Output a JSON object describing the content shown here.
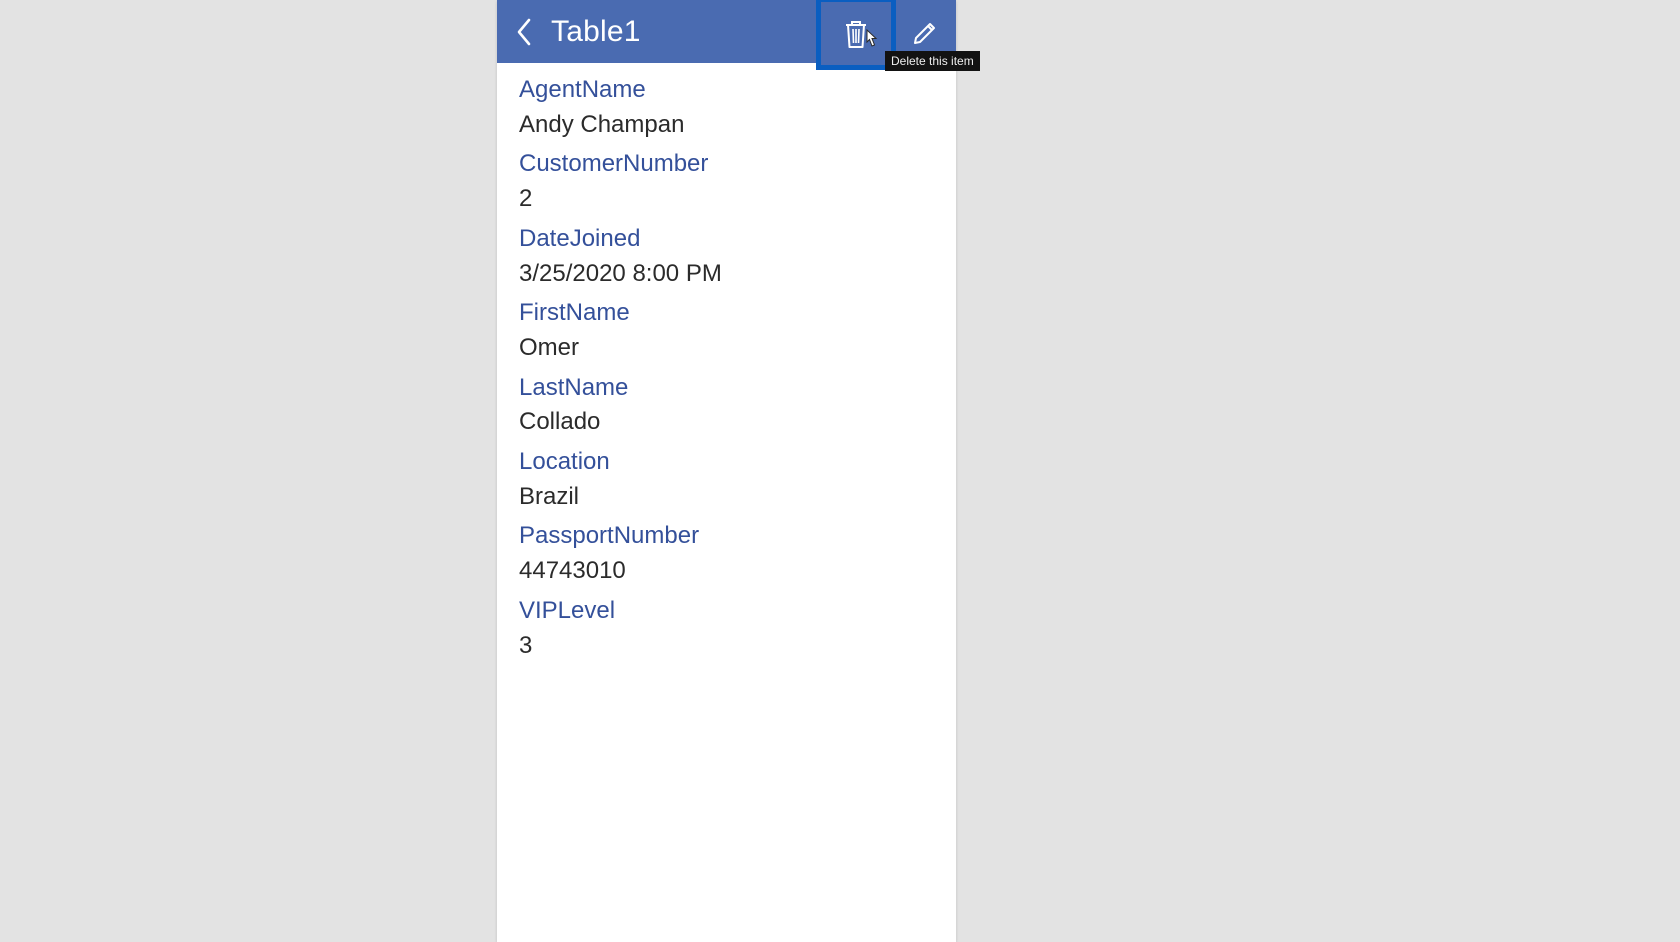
{
  "header": {
    "title": "Table1",
    "tooltip": "Delete this item"
  },
  "fields": [
    {
      "label": "AgentName",
      "value": "Andy Champan"
    },
    {
      "label": "CustomerNumber",
      "value": "2"
    },
    {
      "label": "DateJoined",
      "value": "3/25/2020 8:00 PM"
    },
    {
      "label": "FirstName",
      "value": "Omer"
    },
    {
      "label": "LastName",
      "value": "Collado"
    },
    {
      "label": "Location",
      "value": "Brazil"
    },
    {
      "label": "PassportNumber",
      "value": "44743010"
    },
    {
      "label": "VIPLevel",
      "value": "3"
    }
  ]
}
